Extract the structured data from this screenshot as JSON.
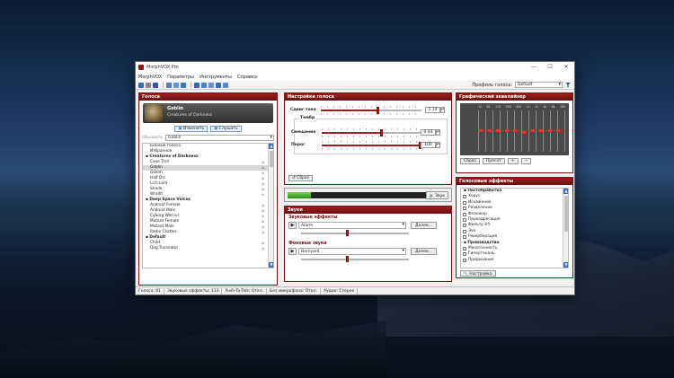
{
  "window": {
    "title": "MorphVOX Pro",
    "controls": [
      "—",
      "☐",
      "✕"
    ]
  },
  "menu": [
    "MorphVOX",
    "Параметры",
    "Инструменты",
    "Справка"
  ],
  "toolbar": {
    "profile_label": "Профиль голоса:",
    "profile_value": "Default"
  },
  "voices_panel": {
    "header": "Голоса",
    "current_name": "Goblin",
    "current_category": "Creatures of Darkness",
    "edit_button": "Изменить",
    "listen_button": "Слушать",
    "filter_button": "Обновить",
    "filter_value": "Goblin",
    "items": [
      {
        "label": "Бинные голоса",
        "type": "item"
      },
      {
        "label": "Избранное",
        "type": "item"
      },
      {
        "label": "Creatures of Darkness",
        "type": "group"
      },
      {
        "label": "Cave Troll",
        "type": "item"
      },
      {
        "label": "Goblin",
        "type": "item",
        "selected": true
      },
      {
        "label": "Golem",
        "type": "item"
      },
      {
        "label": "Half Orc",
        "type": "item"
      },
      {
        "label": "Lich Lord",
        "type": "item"
      },
      {
        "label": "Shade",
        "type": "item"
      },
      {
        "label": "Wraith",
        "type": "item"
      },
      {
        "label": "Deep Space Voices",
        "type": "group"
      },
      {
        "label": "Android Female",
        "type": "item"
      },
      {
        "label": "Android Male",
        "type": "item"
      },
      {
        "label": "Cyborg Warrior",
        "type": "item"
      },
      {
        "label": "Mutant Female",
        "type": "item"
      },
      {
        "label": "Mutant Male",
        "type": "item"
      },
      {
        "label": "Radio Chatter",
        "type": "item"
      },
      {
        "label": "Default",
        "type": "group"
      },
      {
        "label": "Child",
        "type": "item"
      },
      {
        "label": "Dog Translator",
        "type": "item"
      }
    ]
  },
  "tune_panel": {
    "header": "Настройка голоса",
    "timbre_label": "Тембр",
    "reset_button": "Сброс",
    "sliders": [
      {
        "label": "Сдвиг тона",
        "value": "1.14",
        "level": 0.56
      },
      {
        "label": "Смещение",
        "value": "0.44",
        "level": 0.59
      },
      {
        "label": "Порог",
        "value": "100",
        "level": 0.97
      }
    ]
  },
  "level_panel": {
    "sound_button": "Звук",
    "level": 0.17
  },
  "sounds_panel": {
    "header": "Звуки",
    "effects_label": "Звуковые эффекты",
    "effect_value": "Alarm",
    "background_label": "Фоновые звуки",
    "background_value": "Barnyard",
    "more_button": "Далее...",
    "effects_volume": 0.42,
    "background_volume": 0.42
  },
  "eq_panel": {
    "header": "Графический эквалайзер",
    "bands": [
      "31",
      "62",
      "125",
      "250",
      "500",
      "1k",
      "2k",
      "4k",
      "8k",
      "16k"
    ],
    "reset_button": "Сброс",
    "preset_button": "Пресет",
    "add_button": "+",
    "remove_button": "−"
  },
  "fx_panel": {
    "header": "Голосовые эффекты",
    "settings_button": "Настройка",
    "items": [
      {
        "label": "Постобработка",
        "type": "group"
      },
      {
        "label": "Хорус",
        "type": "item"
      },
      {
        "label": "Искажение",
        "type": "item"
      },
      {
        "label": "Разделение",
        "type": "item"
      },
      {
        "label": "Флэнжер",
        "type": "item"
      },
      {
        "label": "Переадресация",
        "type": "item"
      },
      {
        "label": "Фильтр НЧ",
        "type": "item"
      },
      {
        "label": "Эхо",
        "type": "item"
      },
      {
        "label": "Реверберация",
        "type": "item"
      },
      {
        "label": "Производство",
        "type": "group"
      },
      {
        "label": "Монотонность",
        "type": "item"
      },
      {
        "label": "Гипертональ",
        "type": "item"
      },
      {
        "label": "Придыхание",
        "type": "item",
        "checked": true
      }
    ]
  },
  "statusbar": [
    "Голоса: 81",
    "Звуковые эффекты: 113",
    "Push-To-Talk: Откл.",
    "Без микрофона: Откл.",
    "Аудио: Стерео"
  ]
}
